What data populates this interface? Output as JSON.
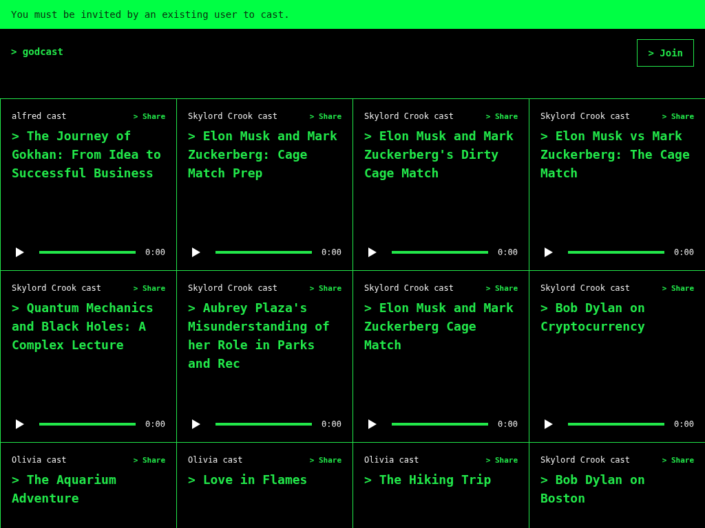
{
  "banner": {
    "text": "You must be invited by an existing user to cast."
  },
  "header": {
    "logo": "> godcast",
    "join_button": "> Join"
  },
  "casts": [
    {
      "author": "alfred cast",
      "share": "> Share",
      "title": "> The Journey of Gokhan: From Idea to Successful Business",
      "time": "0:00"
    },
    {
      "author": "Skylord Crook cast",
      "share": "> Share",
      "title": "> Elon Musk and Mark Zuckerberg: Cage Match Prep",
      "time": "0:00"
    },
    {
      "author": "Skylord Crook cast",
      "share": "> Share",
      "title": "> Elon Musk and Mark Zuckerberg's Dirty Cage Match",
      "time": "0:00"
    },
    {
      "author": "Skylord Crook cast",
      "share": "> Share",
      "title": "> Elon Musk vs Mark Zuckerberg: The Cage Match",
      "time": "0:00"
    },
    {
      "author": "Skylord Crook cast",
      "share": "> Share",
      "title": "> Quantum Mechanics and Black Holes: A Complex Lecture",
      "time": "0:00"
    },
    {
      "author": "Skylord Crook cast",
      "share": "> Share",
      "title": "> Aubrey Plaza's Misunderstanding of her Role in Parks and Rec",
      "time": "0:00"
    },
    {
      "author": "Skylord Crook cast",
      "share": "> Share",
      "title": "> Elon Musk and Mark Zuckerberg Cage Match",
      "time": "0:00"
    },
    {
      "author": "Skylord Crook cast",
      "share": "> Share",
      "title": "> Bob Dylan on Cryptocurrency",
      "time": "0:00"
    },
    {
      "author": "Olivia cast",
      "share": "> Share",
      "title": "> The Aquarium Adventure"
    },
    {
      "author": "Olivia cast",
      "share": "> Share",
      "title": "> Love in Flames"
    },
    {
      "author": "Olivia cast",
      "share": "> Share",
      "title": "> The Hiking Trip"
    },
    {
      "author": "Skylord Crook cast",
      "share": "> Share",
      "title": "> Bob Dylan on Boston"
    }
  ]
}
